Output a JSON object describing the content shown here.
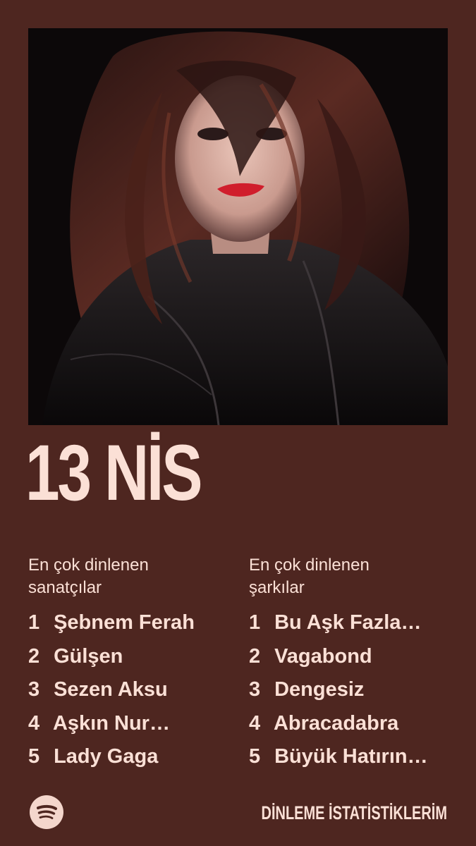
{
  "cover_image": {
    "description_icon": "artist-photo"
  },
  "date_label": "13 NİS",
  "artists": {
    "heading": "En çok dinlenen sanatçılar",
    "items": [
      {
        "rank": "1",
        "name": "Şebnem Ferah"
      },
      {
        "rank": "2",
        "name": "Gülşen"
      },
      {
        "rank": "3",
        "name": "Sezen Aksu"
      },
      {
        "rank": "4",
        "name": "Aşkın Nur…"
      },
      {
        "rank": "5",
        "name": "Lady Gaga"
      }
    ]
  },
  "songs": {
    "heading": "En çok dinlenen şarkılar",
    "items": [
      {
        "rank": "1",
        "name": "Bu Aşk Fazla…"
      },
      {
        "rank": "2",
        "name": "Vagabond"
      },
      {
        "rank": "3",
        "name": "Dengesiz"
      },
      {
        "rank": "4",
        "name": "Abracadabra"
      },
      {
        "rank": "5",
        "name": "Büyük Hatırın…"
      }
    ]
  },
  "footer": {
    "logo_icon": "spotify-logo-icon",
    "title": "DİNLEME İSTATİSTİKLERİM"
  },
  "colors": {
    "background": "#4e2620",
    "text": "#fbe0d6"
  }
}
